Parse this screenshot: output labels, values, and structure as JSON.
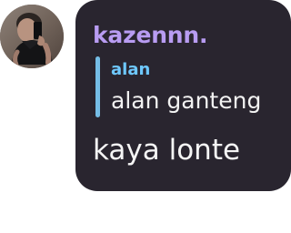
{
  "message": {
    "username": "kazennn.",
    "reply": {
      "author": "alan",
      "text": "alan ganteng"
    },
    "text": "kaya lonte"
  },
  "colors": {
    "bubble_background": "#29252f",
    "username": "#b89cf2",
    "reply_bar": "#75bde6",
    "reply_author": "#6ec8ff",
    "text": "#f5f5f5"
  },
  "icons": {
    "avatar": "user-avatar"
  }
}
